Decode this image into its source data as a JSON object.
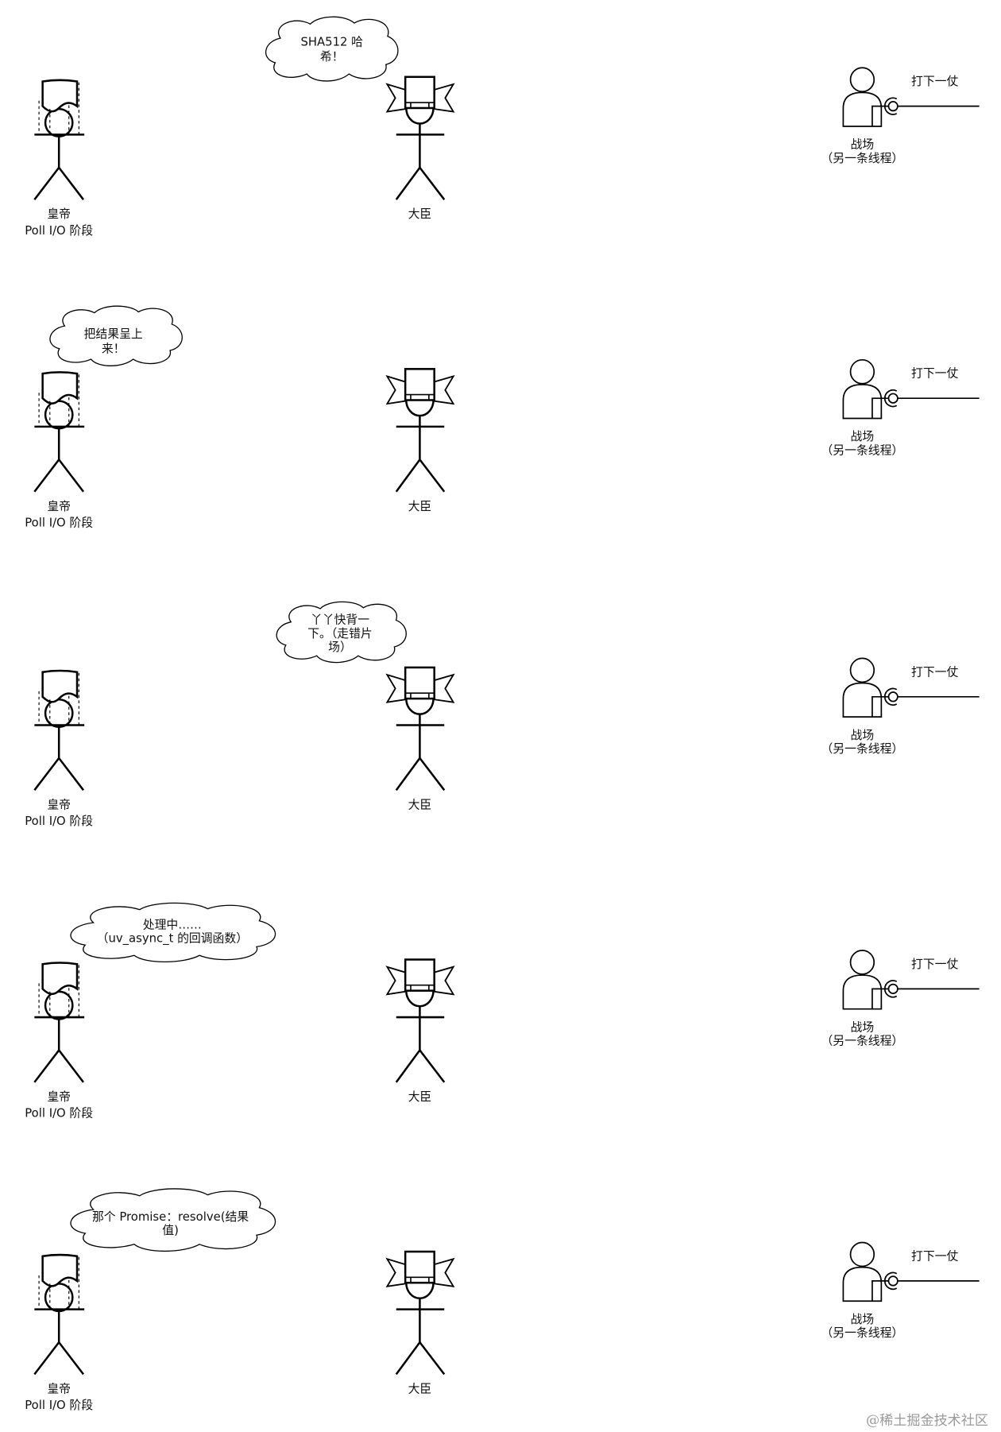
{
  "characters": {
    "emperor": {
      "name": "皇帝",
      "phase": "Poll I/O 阶段"
    },
    "minister": {
      "name": "大臣"
    },
    "battlefield": {
      "name": "战场",
      "note": "（另一条线程）",
      "action": "打下一仗"
    }
  },
  "panels": [
    {
      "bubble": [
        "SHA512 哈",
        "希！"
      ]
    },
    {
      "bubble": [
        "把结果呈上",
        "来！"
      ]
    },
    {
      "bubble": [
        "丫丫快背一",
        "下。（走错片",
        "场）"
      ]
    },
    {
      "bubble": [
        "处理中……",
        "（uv_async_t 的回调函数）"
      ]
    },
    {
      "bubble": [
        "那个 Promise：resolve(结果",
        "值)"
      ]
    }
  ],
  "watermark": "@稀土掘金技术社区"
}
